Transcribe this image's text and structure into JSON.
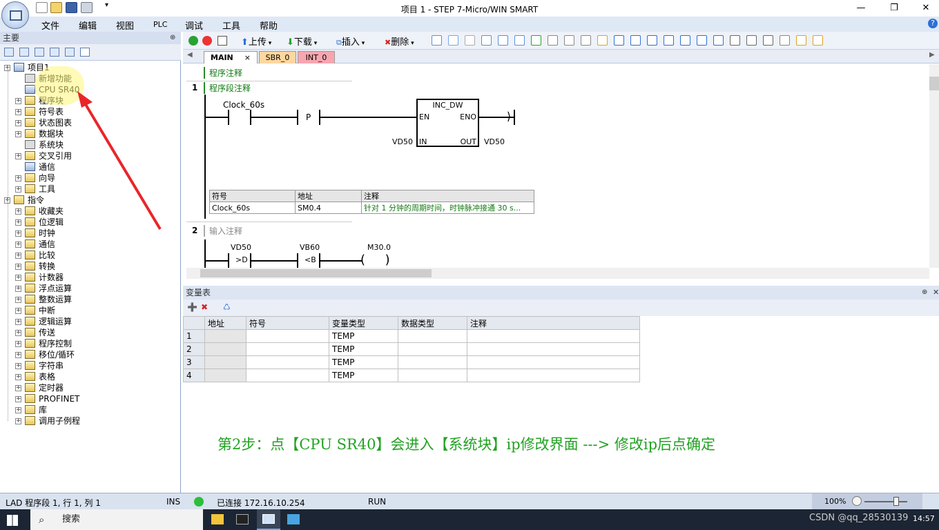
{
  "window": {
    "title": "项目 1 - STEP 7-Micro/WIN SMART",
    "minimize": "—",
    "maximize": "❐",
    "close": "✕"
  },
  "menu": {
    "items": [
      "文件",
      "编辑",
      "视图",
      "PLC",
      "调试",
      "工具",
      "帮助"
    ],
    "help_icon": "?"
  },
  "left_panel": {
    "header": "主要",
    "pin": "⊕",
    "project": {
      "label": "项目1",
      "children": [
        "新增功能",
        "CPU SR40",
        "程序块",
        "符号表",
        "状态图表",
        "数据块",
        "系统块",
        "交叉引用",
        "通信",
        "向导",
        "工具"
      ]
    },
    "instructions": {
      "label": "指令",
      "children": [
        "收藏夹",
        "位逻辑",
        "时钟",
        "通信",
        "比较",
        "转换",
        "计数器",
        "浮点运算",
        "整数运算",
        "中断",
        "逻辑运算",
        "传送",
        "程序控制",
        "移位/循环",
        "字符串",
        "表格",
        "定时器",
        "PROFINET",
        "库",
        "调用子例程"
      ]
    }
  },
  "toolbar": {
    "upload": "上传",
    "download": "下载",
    "insert": "插入",
    "delete": "删除"
  },
  "tabs": [
    {
      "label": "MAIN",
      "close": "×"
    },
    {
      "label": "SBR_0"
    },
    {
      "label": "INT_0"
    }
  ],
  "ladder": {
    "program_comment": "程序注释",
    "network1": {
      "number": "1",
      "comment": "程序段注释",
      "contact": "Clock_60s",
      "p_contact": "P",
      "box_title": "INC_DW",
      "en": "EN",
      "eno": "ENO",
      "in": "IN",
      "out": "OUT",
      "in_var": "VD50",
      "out_var": "VD50",
      "symbol_table": {
        "headers": [
          "符号",
          "地址",
          "注释"
        ],
        "row": [
          "Clock_60s",
          "SM0.4",
          "针对 1 分钟的周期时间，时钟脉冲接通 30 s..."
        ]
      }
    },
    "network2": {
      "number": "2",
      "comment": "输入注释",
      "c1_var": "VD50",
      "c1_op": ">D",
      "c2_var": "VB60",
      "c2_op": "<B",
      "coil_var": "M30.0"
    }
  },
  "var_table": {
    "title": "变量表",
    "pin": "⊕",
    "close": "✕",
    "headers": [
      "地址",
      "符号",
      "变量类型",
      "数据类型",
      "注释"
    ],
    "rows": [
      [
        "1",
        "",
        "",
        "TEMP",
        "",
        ""
      ],
      [
        "2",
        "",
        "",
        "TEMP",
        "",
        ""
      ],
      [
        "3",
        "",
        "",
        "TEMP",
        "",
        ""
      ],
      [
        "4",
        "",
        "",
        "TEMP",
        "",
        ""
      ]
    ]
  },
  "caption": "第2步：点【CPU SR40】会进入【系统块】ip修改界面 ---> 修改ip后点确定",
  "status": {
    "mode": "LAD 程序段 1, 行 1, 列 1",
    "ins": "INS",
    "connected": "已连接 172.16.10.254",
    "run": "RUN",
    "zoom": "100%"
  },
  "taskbar": {
    "search": "搜索",
    "watermark": "CSDN @qq_28530139",
    "time": "14:57"
  },
  "colors": {
    "caption_green": "#21a221",
    "annotation_red": "#e8262a",
    "status_green": "#2bbf3a"
  }
}
